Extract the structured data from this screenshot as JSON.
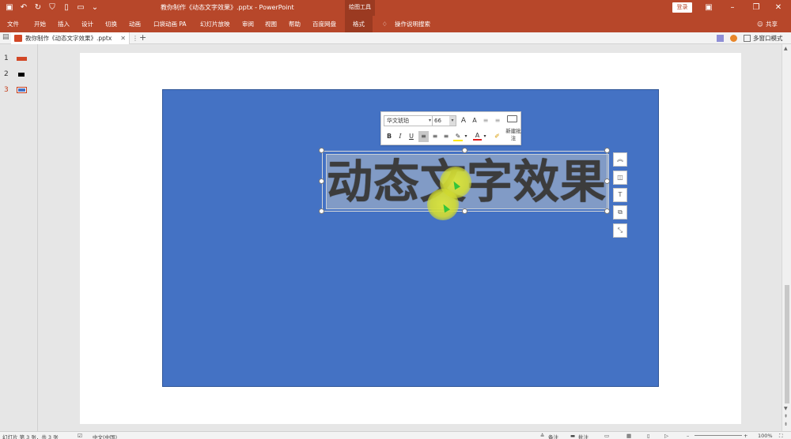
{
  "titlebar": {
    "title": "教你制作《动态文字效果》.pptx  -  PowerPoint",
    "context_tool": "绘图工具",
    "login": "登录",
    "qat_icons": [
      "save-icon",
      "undo-icon",
      "redo-icon",
      "presenter-icon",
      "new-file-icon",
      "open-folder-icon",
      "customize-icon"
    ]
  },
  "ribbon": {
    "tabs": [
      "文件",
      "开始",
      "插入",
      "设计",
      "切换",
      "动画",
      "口袋动画 PA",
      "幻灯片放映",
      "审阅",
      "视图",
      "帮助",
      "百度网盘",
      "格式"
    ],
    "active_tab": "格式",
    "search": "操作说明搜索",
    "share": "共享"
  },
  "doc_tab": {
    "name": "教你制作《动态文字效果》.pptx",
    "close": "✕",
    "add": "+",
    "multiwindow": "多窗口模式"
  },
  "thumbnails": [
    {
      "num": "1",
      "color": "#d24726"
    },
    {
      "num": "2",
      "color": "#000000"
    },
    {
      "num": "3",
      "color": "#4472c4"
    }
  ],
  "textbox": {
    "text": "动态文字效果"
  },
  "minitoolbar": {
    "font_name": "华文琥珀",
    "font_size": "66",
    "grow_font": "A",
    "shrink_font": "A",
    "bold": "B",
    "italic": "I",
    "underline": "U",
    "new_comment": "新建批注"
  },
  "statusbar": {
    "slide_info": "幻灯片 第 3 张，共 3 张",
    "language": "中文(中国)",
    "notes": "备注",
    "comments": "批注",
    "zoom": "100%"
  },
  "colors": {
    "accent": "#b7472a",
    "slide_bg": "#4472c4",
    "font_color_bar": "#e02020"
  }
}
